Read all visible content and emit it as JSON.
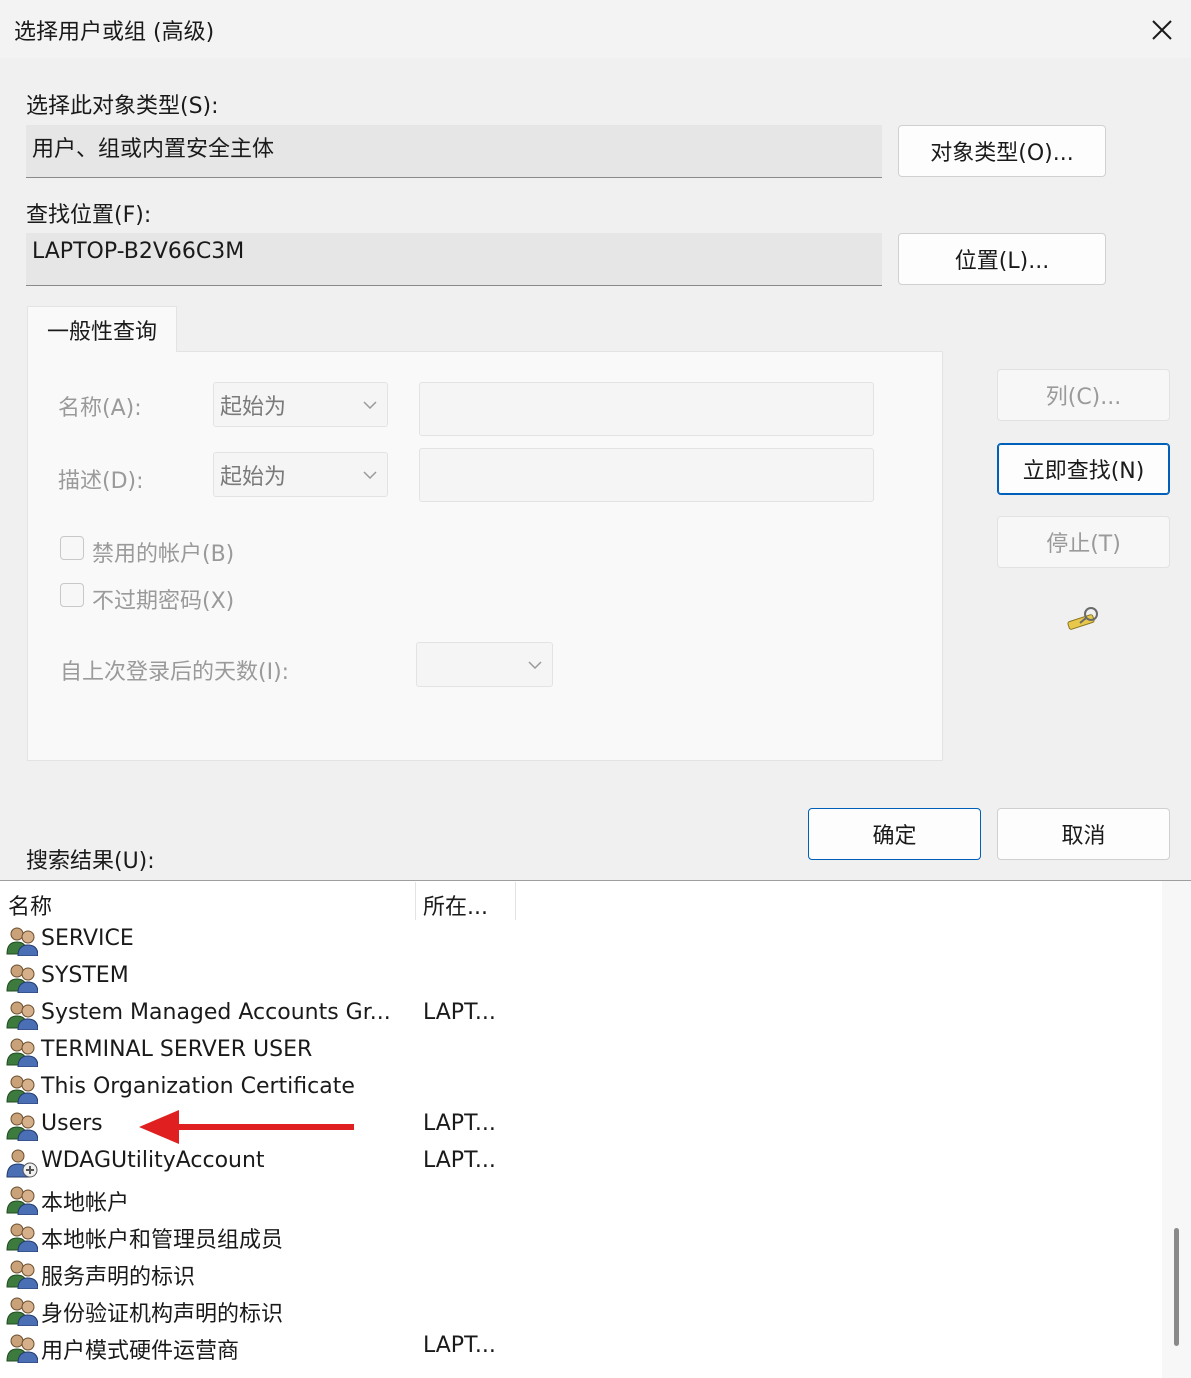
{
  "window": {
    "title": "选择用户或组 (高级)"
  },
  "object_type": {
    "label": "选择此对象类型(S):",
    "value": "用户、组或内置安全主体",
    "button": "对象类型(O)..."
  },
  "location": {
    "label": "查找位置(F):",
    "value": "LAPTOP-B2V66C3M",
    "button": "位置(L)..."
  },
  "general_query": {
    "tab": "一般性查询",
    "name_label": "名称(A):",
    "name_mode": "起始为",
    "desc_label": "描述(D):",
    "desc_mode": "起始为",
    "disabled_accounts": "禁用的帐户(B)",
    "non_expiring_pw": "不过期密码(X)",
    "days_since_logon": "自上次登录后的天数(I):"
  },
  "side_buttons": {
    "columns": "列(C)...",
    "find_now": "立即查找(N)",
    "stop": "停止(T)"
  },
  "dialog_buttons": {
    "ok": "确定",
    "cancel": "取消"
  },
  "results": {
    "label": "搜索结果(U):",
    "columns": [
      "名称",
      "所在..."
    ],
    "rows": [
      {
        "name": "SERVICE",
        "loc": "",
        "icon": "group-icon"
      },
      {
        "name": "SYSTEM",
        "loc": "",
        "icon": "group-icon"
      },
      {
        "name": "System Managed Accounts Gr...",
        "loc": "LAPT...",
        "icon": "group-icon"
      },
      {
        "name": "TERMINAL SERVER USER",
        "loc": "",
        "icon": "group-icon"
      },
      {
        "name": "This Organization Certificate",
        "loc": "",
        "icon": "group-icon"
      },
      {
        "name": "Users",
        "loc": "LAPT...",
        "icon": "group-icon"
      },
      {
        "name": "WDAGUtilityAccount",
        "loc": "LAPT...",
        "icon": "user-icon"
      },
      {
        "name": "本地帐户",
        "loc": "",
        "icon": "group-icon"
      },
      {
        "name": "本地帐户和管理员组成员",
        "loc": "",
        "icon": "group-icon"
      },
      {
        "name": "服务声明的标识",
        "loc": "",
        "icon": "group-icon"
      },
      {
        "name": "身份验证机构声明的标识",
        "loc": "",
        "icon": "group-icon"
      },
      {
        "name": "用户模式硬件运营商",
        "loc": "LAPT...",
        "icon": "group-icon"
      }
    ]
  },
  "annotation": {
    "color": "#e02020"
  },
  "colors": {
    "accent": "#005fb8"
  }
}
